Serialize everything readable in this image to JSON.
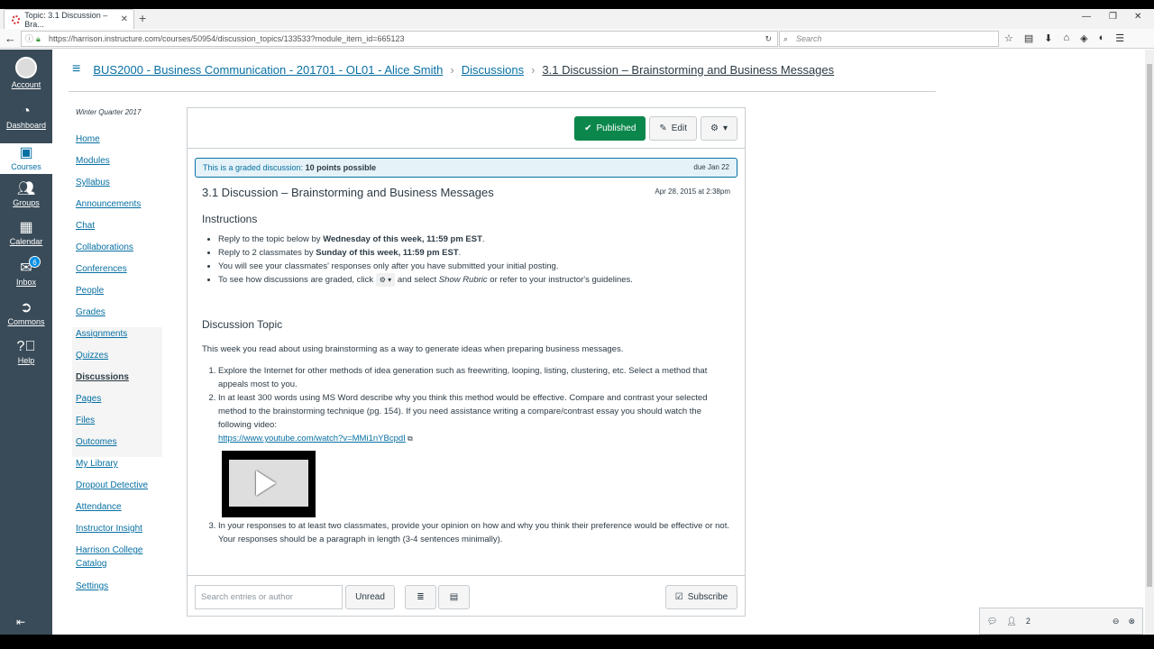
{
  "browser": {
    "tab_title": "Topic: 3.1 Discussion – Bra...",
    "url": "https://harrison.instructure.com/courses/50954/discussion_topics/133533?module_item_id=665123",
    "search_placeholder": "Search"
  },
  "global_nav": {
    "items": [
      {
        "label": "Account",
        "icon": "avatar"
      },
      {
        "label": "Dashboard",
        "icon": "dashboard-icon"
      },
      {
        "label": "Courses",
        "icon": "courses-icon"
      },
      {
        "label": "Groups",
        "icon": "groups-icon"
      },
      {
        "label": "Calendar",
        "icon": "calendar-icon"
      },
      {
        "label": "Inbox",
        "icon": "inbox-icon",
        "badge": "6"
      },
      {
        "label": "Commons",
        "icon": "commons-icon"
      },
      {
        "label": "Help",
        "icon": "help-icon"
      }
    ]
  },
  "breadcrumb": {
    "course": "BUS2000 - Business Communication - 201701 - OL01 - Alice Smith",
    "section": "Discussions",
    "current": "3.1 Discussion – Brainstorming and Business Messages"
  },
  "course_nav": {
    "term": "Winter Quarter 2017",
    "items": [
      "Home",
      "Modules",
      "Syllabus",
      "Announcements",
      "Chat",
      "Collaborations",
      "Conferences",
      "People",
      "Grades",
      "Assignments",
      "Quizzes",
      "Discussions",
      "Pages",
      "Files",
      "Outcomes",
      "My Library",
      "Dropout Detective",
      "Attendance",
      "Instructor Insight",
      "Harrison College Catalog",
      "Settings"
    ]
  },
  "header": {
    "published": "Published",
    "edit": "Edit"
  },
  "graded": {
    "lead": "This is a graded discussion:",
    "points": "10 points possible",
    "due": "due Jan 22"
  },
  "topic": {
    "title": "3.1 Discussion – Brainstorming and Business Messages",
    "posted": "Apr 28, 2015 at 2:38pm",
    "instructions_heading": "Instructions",
    "instr": {
      "i1a": "Reply to the topic below by ",
      "i1b": "Wednesday of this week, 11:59 pm EST",
      "i1c": ".",
      "i2a": "Reply to 2 classmates by ",
      "i2b": "Sunday of this week, 11:59 pm EST",
      "i2c": ".",
      "i3": "You will see your classmates' responses only after you have submitted your initial posting.",
      "i4a": "To see how discussions are graded, click ",
      "i4b": "and select ",
      "i4c": "Show Rubric",
      "i4d": " or refer to your instructor's guidelines."
    },
    "topic_heading": "Discussion Topic",
    "intro": "This week you read about using brainstorming as a way to generate ideas when preparing business messages.",
    "steps": {
      "s1": "Explore the Internet for other methods of idea generation such as freewriting, looping, listing, clustering, etc. Select a method that appeals most to you.",
      "s2": "In at least 300 words using MS Word describe why you think this method would be effective. Compare and contrast your selected method to the brainstorming technique (pg. 154). If you need assistance writing a compare/contrast essay you should watch the following video:",
      "link": "https://www.youtube.com/watch?v=MMi1nYBcpdI",
      "s3": "In your responses to at least two classmates, provide your opinion on how and why you think their preference would be effective or not. Your responses should be a paragraph in length (3-4 sentences minimally)."
    }
  },
  "toolbar": {
    "search_placeholder": "Search entries or author",
    "unread": "Unread",
    "subscribe": "Subscribe"
  },
  "chat": {
    "count": "2"
  }
}
